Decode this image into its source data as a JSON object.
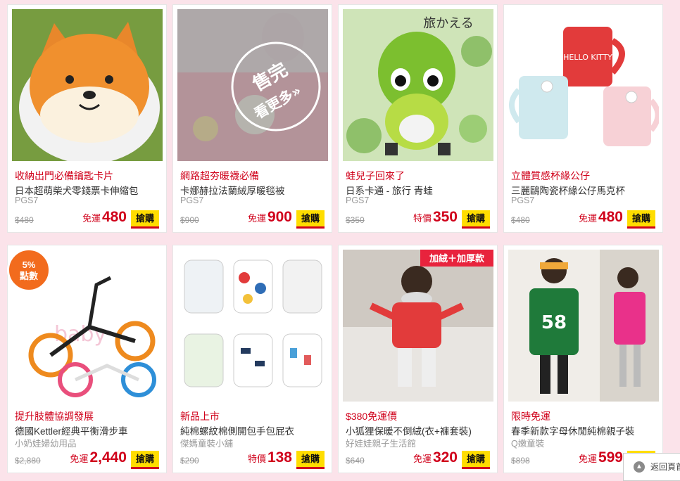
{
  "products": [
    {
      "tag": "收納出門必備鑰匙卡片",
      "name": "日本超萌柴犬零錢票卡伸縮包",
      "shop": "PGS7",
      "orig": "$480",
      "deal_label": "免運",
      "price": "480",
      "buy": "搶購"
    },
    {
      "tag": "網路超夯暖襪必備",
      "name": "卡娜赫拉法蘭絨厚暖毯被",
      "shop": "PGS7",
      "orig": "$900",
      "deal_label": "免運",
      "price": "900",
      "buy": "搶購",
      "overlay": {
        "line1": "售完",
        "line2": "看更多»"
      }
    },
    {
      "tag": "蛙兒子回來了",
      "name": "日系卡通 - 旅行 青蛙",
      "shop": "PGS7",
      "orig": "$350",
      "deal_label": "特價",
      "price": "350",
      "buy": "搶購",
      "img_text": "旅かえる"
    },
    {
      "tag": "立體質感杯緣公仔",
      "name": "三麗鷗陶瓷杯緣公仔馬克杯",
      "shop": "PGS7",
      "orig": "$480",
      "deal_label": "免運",
      "price": "480",
      "buy": "搶購",
      "img_text": "HELLO KITTY"
    },
    {
      "tag": "提升肢體協調發展",
      "name": "德國Kettler經典平衡滑步車",
      "shop": "小奶娃婦幼用品",
      "orig": "$2,880",
      "deal_label": "免運",
      "price": "2,440",
      "buy": "搶購",
      "badge": {
        "line1": "5%",
        "line2": "點數"
      }
    },
    {
      "tag": "新品上市",
      "name": "純棉螺紋棉側開包手包屁衣",
      "shop": "傑媽童裝小舖",
      "orig": "$290",
      "deal_label": "特價",
      "price": "138",
      "buy": "搶購"
    },
    {
      "tag": "$380免運價",
      "name": "小狐狸保暖不倒絨(衣+褲套裝)",
      "shop": "好娃娃親子生活館",
      "orig": "$640",
      "deal_label": "免運",
      "price": "320",
      "buy": "搶購",
      "img_text": "加絨＋加厚款"
    },
    {
      "tag": "限時免運",
      "name": "春季新款字母休閒純棉親子裝",
      "shop": "Q嫩童裝",
      "orig": "$898",
      "deal_label": "免運",
      "price": "599",
      "buy": "搶購",
      "img_text": "58"
    }
  ],
  "back_to_top": "返回頁首",
  "colors": {
    "accent": "#d0021b",
    "buy_bg": "#ffdd00",
    "page_bg": "#fbe3ea",
    "badge": "#f26b1d"
  }
}
